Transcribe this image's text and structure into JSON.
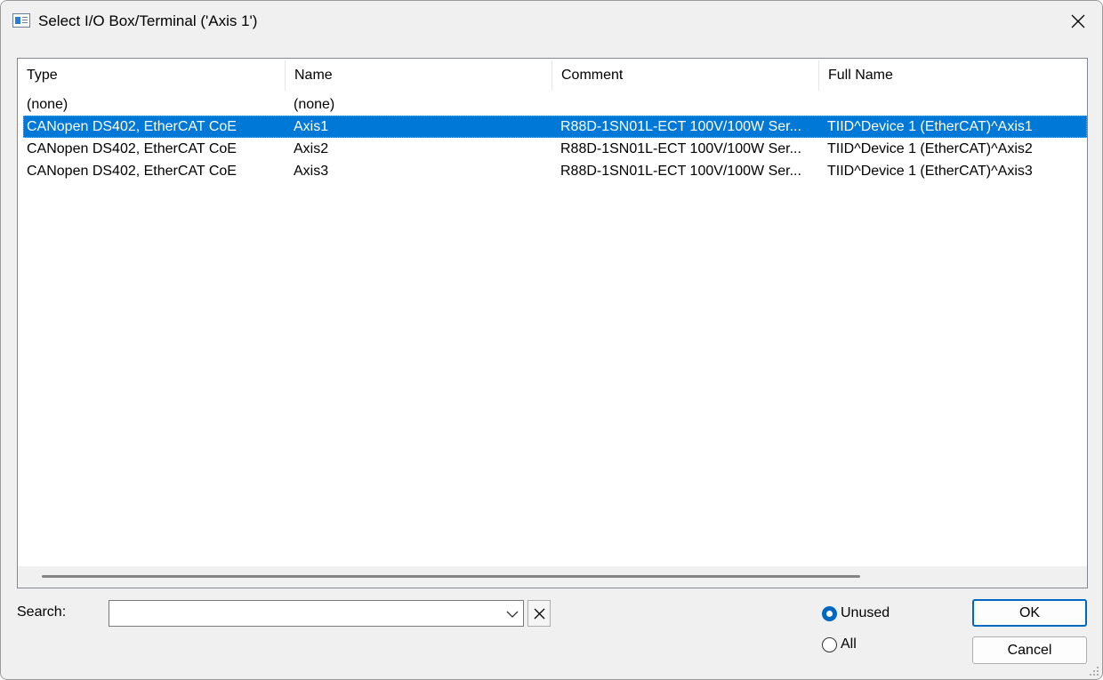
{
  "window": {
    "title": "Select I/O Box/Terminal ('Axis 1')"
  },
  "list": {
    "columns": [
      "Type",
      "Name",
      "Comment",
      "Full Name"
    ],
    "rows": [
      {
        "type": "(none)",
        "name": "(none)",
        "comment": "",
        "full_name": "",
        "selected": false
      },
      {
        "type": "CANopen DS402, EtherCAT CoE",
        "name": "Axis1",
        "comment": "R88D-1SN01L-ECT 100V/100W Ser...",
        "full_name": "TIID^Device 1 (EtherCAT)^Axis1",
        "selected": true
      },
      {
        "type": "CANopen DS402, EtherCAT CoE",
        "name": "Axis2",
        "comment": "R88D-1SN01L-ECT 100V/100W Ser...",
        "full_name": "TIID^Device 1 (EtherCAT)^Axis2",
        "selected": false
      },
      {
        "type": "CANopen DS402, EtherCAT CoE",
        "name": "Axis3",
        "comment": "R88D-1SN01L-ECT 100V/100W Ser...",
        "full_name": "TIID^Device 1 (EtherCAT)^Axis3",
        "selected": false
      }
    ]
  },
  "search": {
    "label": "Search:",
    "value": ""
  },
  "filter": {
    "options": [
      {
        "label": "Unused",
        "checked": true
      },
      {
        "label": "All",
        "checked": false
      }
    ]
  },
  "buttons": {
    "ok": "OK",
    "cancel": "Cancel"
  },
  "colors": {
    "selection": "#0078d7",
    "accent": "#0067c0"
  },
  "icons": {
    "app": "dialog-app-icon",
    "close": "close-icon",
    "dropdown": "chevron-down-icon",
    "clear": "clear-x-icon"
  }
}
